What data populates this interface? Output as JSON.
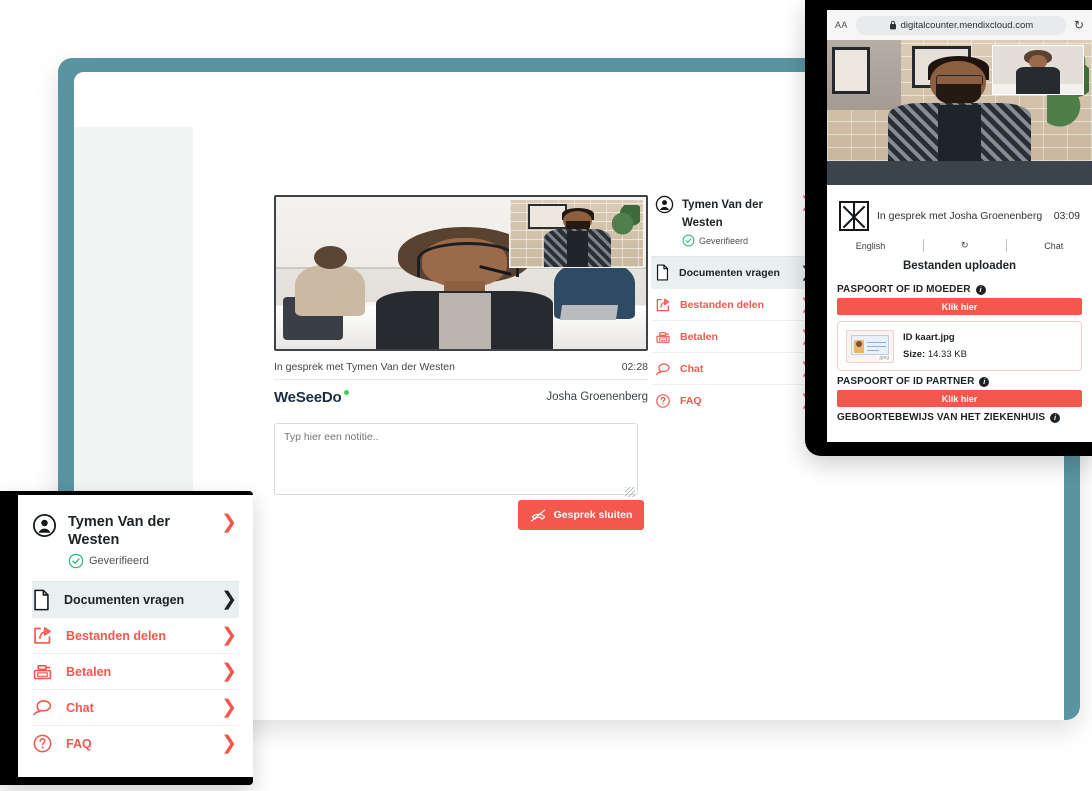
{
  "desktop": {
    "video": {
      "caption": "In gesprek met Tymen Van der Westen",
      "timer": "02:28",
      "alt": "video-call-agent"
    },
    "brand": "WeSeeDo",
    "guest_name": "Josha Groenenberg",
    "note_placeholder": "Typ hier een notitie..",
    "end_call_button": "Gesprek sluiten",
    "menu": {
      "contact_name": "Tymen Van der Westen",
      "verified_label": "Geverifieerd",
      "items": [
        {
          "label": "Documenten vragen",
          "icon": "document-icon",
          "active": true
        },
        {
          "label": "Bestanden delen",
          "icon": "share-icon",
          "active": false
        },
        {
          "label": "Betalen",
          "icon": "cash-register-icon",
          "active": false
        },
        {
          "label": "Chat",
          "icon": "chat-bubbles-icon",
          "active": false
        },
        {
          "label": "FAQ",
          "icon": "question-circle-icon",
          "active": false
        }
      ]
    }
  },
  "phone": {
    "browser": {
      "aa_label": "AA",
      "url": "digitalcounter.mendixcloud.com",
      "lock_icon": "lock-icon",
      "reload_icon": "reload-icon"
    },
    "call": {
      "text": "In gesprek met Josha Groenenberg",
      "timer": "03:09"
    },
    "tools": {
      "language": "English",
      "refresh_icon": "refresh-icon",
      "chat": "Chat"
    },
    "upload_title": "Bestanden uploaden",
    "sections": [
      {
        "label": "PASPOORT OF ID MOEDER",
        "button": "Klik hier"
      },
      {
        "label": "PASPOORT OF ID PARTNER",
        "button": "Klik hier"
      },
      {
        "label": "GEBOORTEBEWIJS VAN HET ZIEKENHUIS",
        "button": "Klik hier"
      }
    ],
    "file": {
      "name": "ID kaart.jpg",
      "size_label": "Size:",
      "size_value": "14.33 KB",
      "ext_badge": "jpeg"
    }
  },
  "card_left": {
    "contact_name": "Tymen Van der Westen",
    "verified_label": "Geverifieerd",
    "items": [
      {
        "label": "Documenten vragen",
        "icon": "document-icon",
        "active": true
      },
      {
        "label": "Bestanden delen",
        "icon": "share-icon",
        "active": false
      },
      {
        "label": "Betalen",
        "icon": "cash-register-icon",
        "active": false
      },
      {
        "label": "Chat",
        "icon": "chat-bubbles-icon",
        "active": false
      },
      {
        "label": "FAQ",
        "icon": "question-circle-icon",
        "active": false
      }
    ]
  },
  "colors": {
    "accent_red": "#f4574c",
    "frame_teal": "#5a94a0",
    "verified_green": "#2eb872",
    "dark_text": "#1d2226"
  }
}
